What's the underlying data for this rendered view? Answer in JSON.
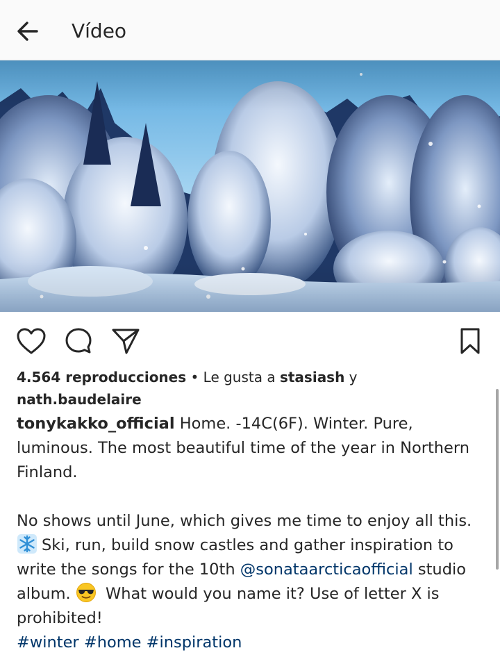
{
  "header": {
    "title": "Vídeo",
    "back_icon": "arrow-left-icon"
  },
  "video": {
    "description_icon": "snowy-forest-thumbnail"
  },
  "actions": {
    "like_icon": "heart-icon",
    "comment_icon": "comment-bubble-icon",
    "share_icon": "paper-plane-icon",
    "save_icon": "bookmark-icon"
  },
  "post": {
    "views_count": "4.564 reproducciones",
    "separator": " • ",
    "liked_by_prefix": "Le gusta a ",
    "liked_by_user1": "stasiash",
    "liked_by_and": " y ",
    "liked_by_user2": "nath.baudelaire",
    "author": "tonykakko_official",
    "caption_part1": " Home. -14C(6F). Winter. Pure, luminous. The most beautiful time of the year in Northern Finland.",
    "caption_part2": "No shows until June, which gives me time to enjoy all this.",
    "caption_part3": "Ski, run, build snow castles and gather inspiration to write the songs for the 10th ",
    "mention": "@sonataarcticaofficial",
    "caption_part4": " studio album.",
    "caption_part5": " What would you name it? Use of letter X is prohibited!",
    "hashtags": [
      "#winter",
      "#home",
      "#inspiration"
    ],
    "emoji_snowflake": "snowflake-emoji-icon",
    "emoji_sunglasses": "sunglasses-emoji-icon"
  },
  "colors": {
    "link": "#003569",
    "text": "#262626",
    "header_bg": "#fafafa"
  }
}
